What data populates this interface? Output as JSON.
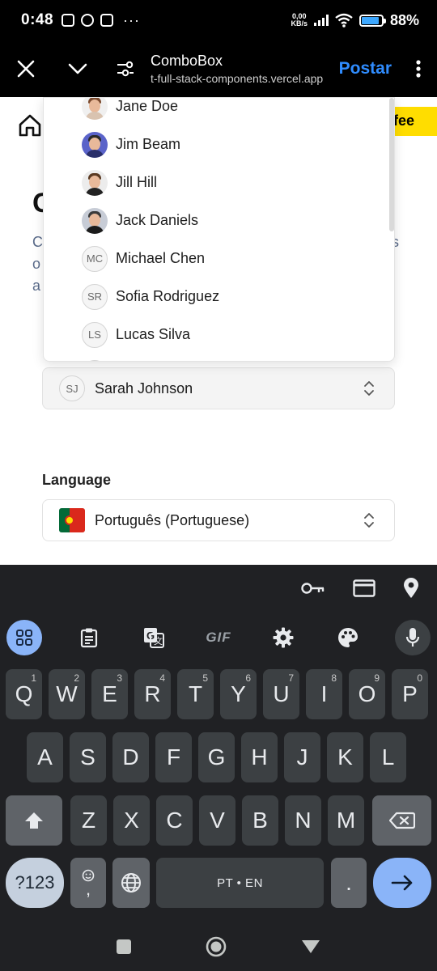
{
  "status_bar": {
    "time": "0:48",
    "net_speed_value": "0,00",
    "net_speed_unit": "KB/s",
    "battery_percent": "88%",
    "battery_level": 0.88
  },
  "app_bar": {
    "title": "ComboBox",
    "url": "t-full-stack-components.vercel.app",
    "post_label": "Postar",
    "accent_color": "#2f8cff"
  },
  "page": {
    "coffee_label": "fee",
    "heading_fragment": "C",
    "paragraph_left": [
      "C",
      "o",
      "a"
    ],
    "paragraph_right": "s",
    "person_combo": {
      "initials": "SJ",
      "value": "Sarah Johnson"
    },
    "language_label": "Language",
    "language_combo": {
      "value": "Português (Portuguese)"
    }
  },
  "dropdown": {
    "items": [
      {
        "name": "Jane Doe",
        "avatar": "photo"
      },
      {
        "name": "Jim Beam",
        "avatar": "photo"
      },
      {
        "name": "Jill Hill",
        "avatar": "photo"
      },
      {
        "name": "Jack Daniels",
        "avatar": "photo"
      },
      {
        "name": "Michael Chen",
        "avatar": "initials",
        "initials": "MC"
      },
      {
        "name": "Sofia Rodriguez",
        "avatar": "initials",
        "initials": "SR"
      },
      {
        "name": "Lucas Silva",
        "avatar": "initials",
        "initials": "LS"
      }
    ]
  },
  "keyboard": {
    "row1": [
      {
        "k": "Q",
        "n": "1"
      },
      {
        "k": "W",
        "n": "2"
      },
      {
        "k": "E",
        "n": "3"
      },
      {
        "k": "R",
        "n": "4"
      },
      {
        "k": "T",
        "n": "5"
      },
      {
        "k": "Y",
        "n": "6"
      },
      {
        "k": "U",
        "n": "7"
      },
      {
        "k": "I",
        "n": "8"
      },
      {
        "k": "O",
        "n": "9"
      },
      {
        "k": "P",
        "n": "0"
      }
    ],
    "row2": [
      "A",
      "S",
      "D",
      "F",
      "G",
      "H",
      "J",
      "K",
      "L"
    ],
    "row3": [
      "Z",
      "X",
      "C",
      "V",
      "B",
      "N",
      "M"
    ],
    "symbols_label": "?123",
    "emoji_comma": ",",
    "space_label": "PT • EN",
    "period_label": ".",
    "gif_label": "GIF",
    "icons": [
      "key-icon",
      "card-icon",
      "location-icon",
      "apps-grid-icon",
      "clipboard-icon",
      "translate-icon",
      "settings-icon",
      "palette-icon",
      "mic-icon",
      "shift-icon",
      "backspace-icon",
      "emoji-icon",
      "globe-icon",
      "enter-arrow-icon"
    ]
  }
}
